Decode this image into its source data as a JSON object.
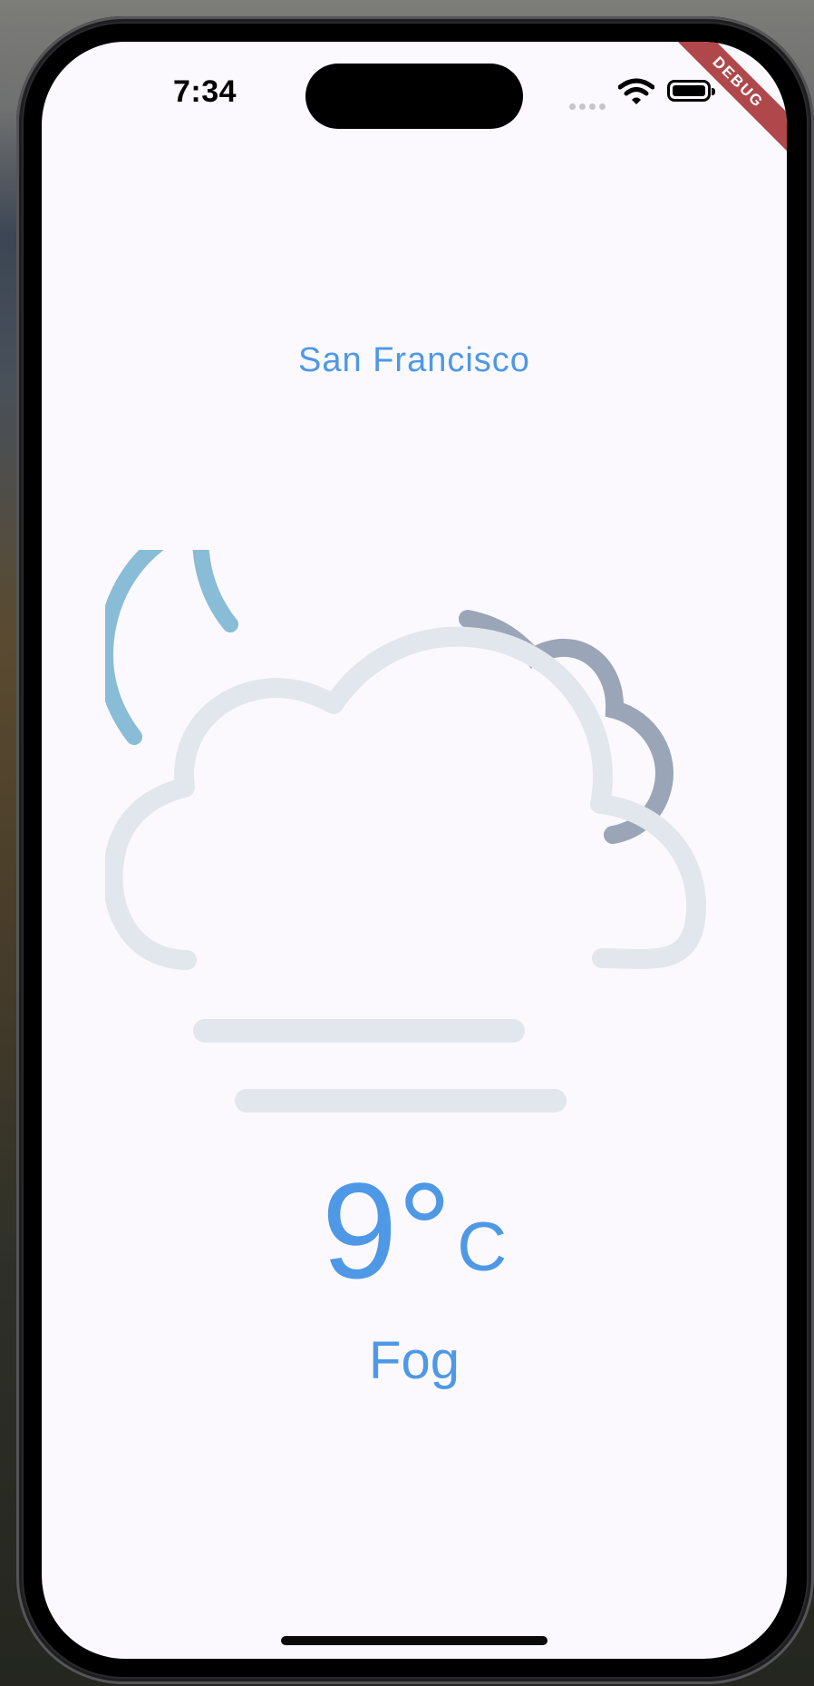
{
  "status_bar": {
    "time": "7:34"
  },
  "debug_banner": {
    "label": "DEBUG"
  },
  "weather": {
    "city": "San Francisco",
    "temperature": "9°",
    "unit": "C",
    "condition": "Fog",
    "icon": "fog-night-icon"
  },
  "colors": {
    "accent": "#4e98e6",
    "background": "#fbf9fd",
    "moon": "#89bcd6",
    "cloud_front": "#e2e7ed",
    "cloud_back": "#9aa5b8",
    "debug_banner": "#b0474a"
  }
}
